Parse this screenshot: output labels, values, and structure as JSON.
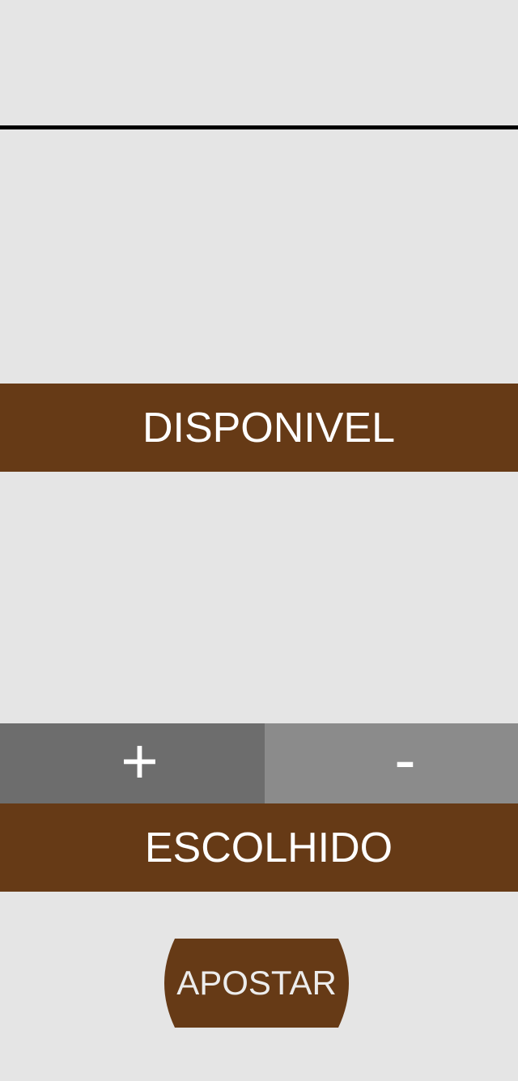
{
  "available": {
    "label": "DISPONIVEL"
  },
  "stepper": {
    "plus_label": "+",
    "minus_label": "-"
  },
  "chosen": {
    "label": "ESCOLHIDO"
  },
  "bet_button": {
    "label": "APOSTAR"
  },
  "colors": {
    "background": "#e5e5e5",
    "accent_brown": "#663a16",
    "plus_button": "#6d6d6d",
    "minus_button": "#8b8b8b",
    "divider": "#000000"
  }
}
